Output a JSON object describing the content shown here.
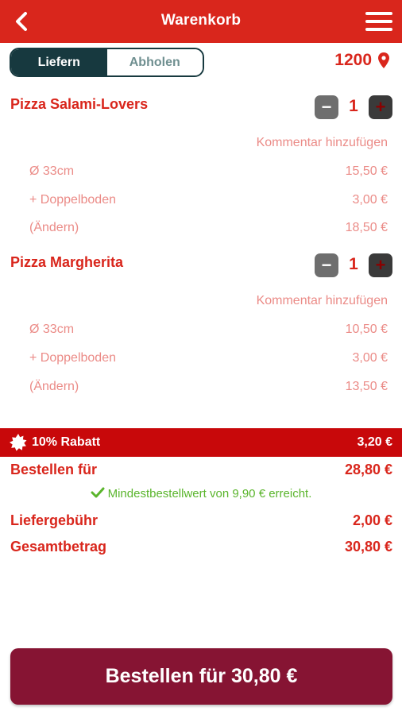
{
  "header": {
    "title": "Warenkorb"
  },
  "mode": {
    "deliver_label": "Liefern",
    "pickup_label": "Abholen",
    "postal_code": "1200"
  },
  "items": [
    {
      "name": "Pizza Salami-Lovers",
      "quantity": "1",
      "comment_label": "Kommentar hinzufügen",
      "options": [
        {
          "label": "Ø 33cm",
          "price": "15,50 €"
        },
        {
          "label": "+ Doppelboden",
          "price": "3,00 €"
        },
        {
          "label": "(Ändern)",
          "price": "18,50 €"
        }
      ]
    },
    {
      "name": "Pizza Margherita",
      "quantity": "1",
      "comment_label": "Kommentar hinzufügen",
      "options": [
        {
          "label": "Ø 33cm",
          "price": "10,50 €"
        },
        {
          "label": "+ Doppelboden",
          "price": "3,00 €"
        },
        {
          "label": "(Ändern)",
          "price": "13,50 €"
        }
      ]
    }
  ],
  "discount": {
    "label": "10% Rabatt",
    "amount": "3,20 €"
  },
  "summary": {
    "order_for_label": "Bestellen für",
    "order_for_value": "28,80 €",
    "min_order_message": "Mindestbestellwert von 9,90 € erreicht.",
    "delivery_fee_label": "Liefergebühr",
    "delivery_fee_value": "2,00 €",
    "total_label": "Gesamtbetrag",
    "total_value": "30,80 €"
  },
  "order_button_label": "Bestellen für 30,80 €",
  "colors": {
    "primary": "#d9261c",
    "toggle_dark": "#17393f",
    "order_button": "#861433",
    "success": "#5ab52c"
  }
}
